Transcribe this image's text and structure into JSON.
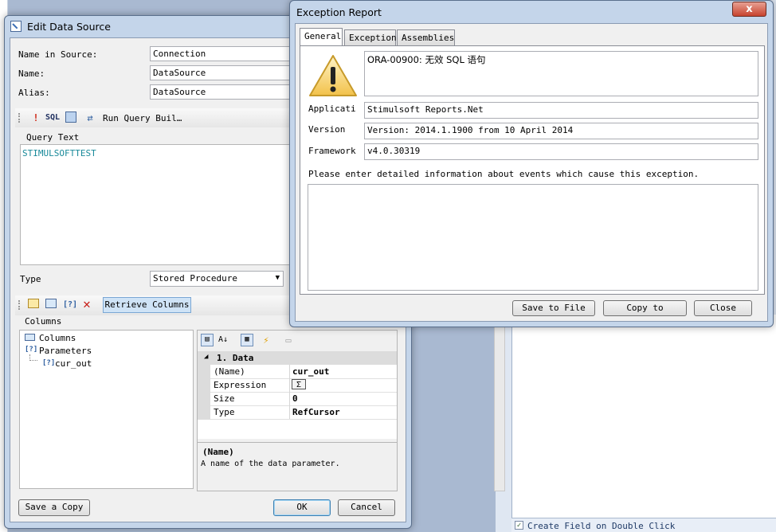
{
  "background": {
    "status_checkbox_label": "Create Field on Double Click"
  },
  "edit_dialog": {
    "title": "Edit Data Source",
    "name_in_source_label": "Name in Source:",
    "name_in_source_value": "Connection",
    "name_label": "Name:",
    "name_value": "DataSource",
    "alias_label": "Alias:",
    "alias_value": "DataSource",
    "toolbar": {
      "sql_label": "SQL",
      "run_query_builder_label": "Run Query Buil…"
    },
    "query_text_label": "Query Text",
    "query_text": "STIMULSOFTTEST",
    "type_label": "Type",
    "type_value": "Stored Procedure",
    "retrieve_columns_label": "Retrieve Columns",
    "columns_group_label": "Columns",
    "tree": {
      "columns": "Columns",
      "parameters": "Parameters",
      "param_item": "cur_out"
    },
    "property_grid": {
      "category": "1. Data",
      "rows": [
        {
          "name": "(Name)",
          "value": "cur_out"
        },
        {
          "name": "Expression",
          "value": "Σ"
        },
        {
          "name": "Size",
          "value": "0"
        },
        {
          "name": "Type",
          "value": "RefCursor"
        }
      ],
      "help_title": "(Name)",
      "help_text": "A name of the data parameter."
    },
    "save_copy_label": "Save a Copy",
    "ok_label": "OK",
    "cancel_label": "Cancel"
  },
  "exception_dialog": {
    "title": "Exception Report",
    "close_glyph": "x",
    "tabs": [
      "General",
      "Exception",
      "Assemblies"
    ],
    "message": "ORA-00900: 无效 SQL 语句",
    "application_label": "Applicati",
    "application_value": "Stimulsoft Reports.Net",
    "version_label": "Version",
    "version_value": "Version: 2014.1.1900 from 10 April 2014",
    "framework_label": "Framework",
    "framework_value": "v4.0.30319",
    "prompt": "Please enter detailed information about events which cause this exception.",
    "details_value": "",
    "save_to_file_label": "Save to File",
    "copy_to_label": "Copy to",
    "close_label": "Close"
  }
}
